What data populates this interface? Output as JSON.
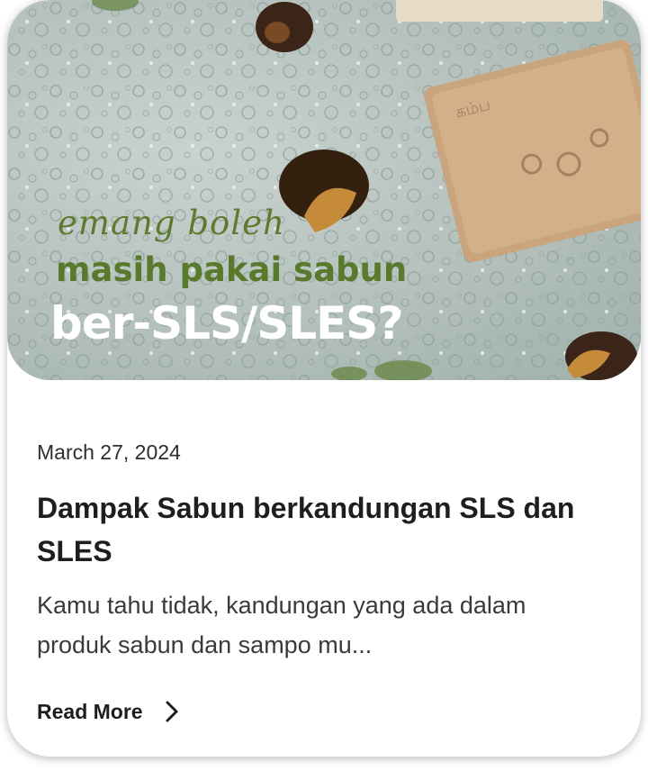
{
  "post": {
    "image_text": {
      "line1": "emang boleh",
      "line2": "masih pakai sabun",
      "line3": "ber-SLS/SLES?"
    },
    "date": "March 27, 2024",
    "title": "Dampak Sabun berkandungan SLS dan SLES",
    "excerpt": "Kamu tahu tidak, kandungan yang ada dalam produk sabun dan sampo mu...",
    "read_more_label": "Read More",
    "read_more_icon": "chevron-right-icon"
  },
  "colors": {
    "headline_green": "#5d7a2e",
    "headline_white": "#ffffff",
    "text_dark": "#1e1e1e",
    "card_background": "#ffffff"
  }
}
